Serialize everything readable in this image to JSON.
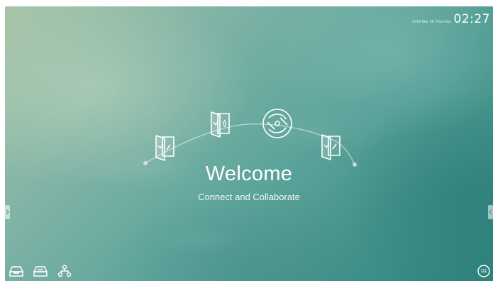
{
  "status_bar": {
    "date": "2018 Mar 08 Thursday",
    "time": "02:27"
  },
  "welcome": {
    "title": "Welcome",
    "subtitle": "Connect and Collaborate"
  },
  "icons": {
    "flow": [
      "door-check-icon-left",
      "door-wireless-icon",
      "camera-shutter-icon",
      "door-check-icon-right"
    ],
    "dock": [
      "tray-icon",
      "tray-alt-icon",
      "network-icon"
    ],
    "apps": "apps-grid-icon",
    "side_tabs": [
      "left-arrow-tab",
      "right-arrow-tab"
    ]
  },
  "colors": {
    "background_top_left": "#a8c4a7",
    "background_bottom_right": "#2f827b",
    "foreground": "#ffffff"
  }
}
